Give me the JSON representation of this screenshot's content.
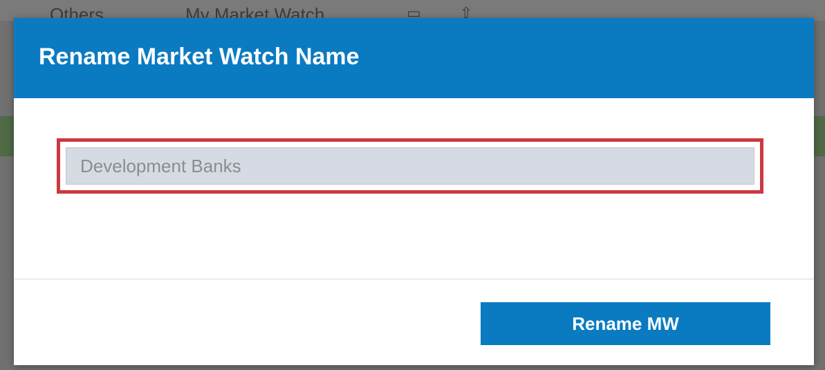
{
  "background": {
    "tabs": {
      "others_label": "Others",
      "market_watch_label": "My Market Watch",
      "icons": [
        "grid-icon",
        "upload-icon"
      ]
    }
  },
  "modal": {
    "title": "Rename Market Watch Name",
    "name_input": {
      "value": "",
      "placeholder": "Development Banks"
    },
    "rename_button_label": "Rename MW"
  },
  "colors": {
    "header_blue": "#0b7bc1",
    "highlight_red": "#cc3840",
    "input_bg": "#d6dae3",
    "button_blue": "#0b7bc1"
  }
}
